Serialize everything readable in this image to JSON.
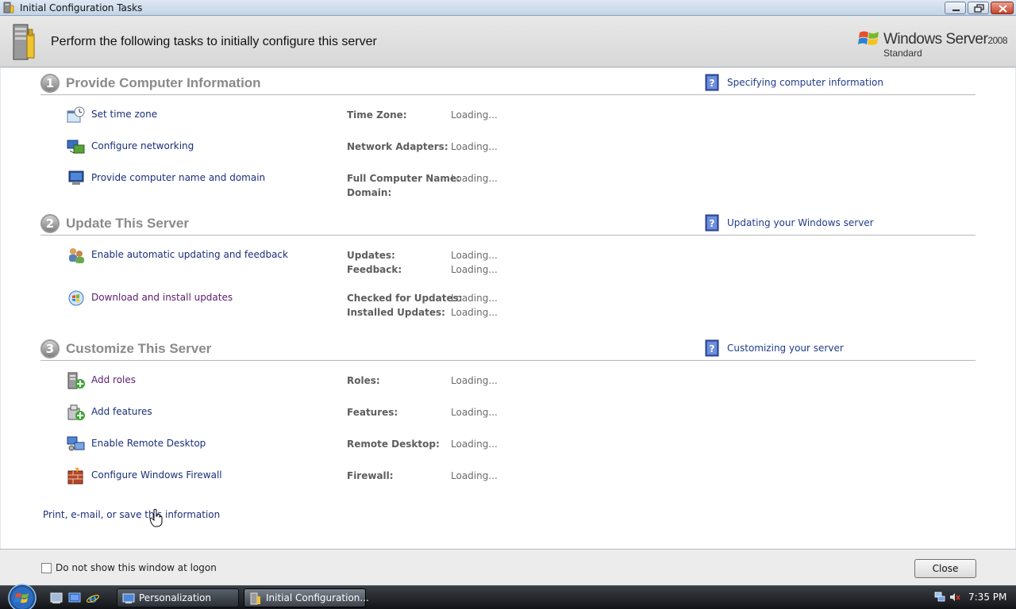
{
  "window": {
    "title": "Initial Configuration Tasks"
  },
  "header": {
    "title": "Perform the following tasks to initially configure this server",
    "brand_name": "Windows Server",
    "brand_version": "2008",
    "brand_edition": "Standard"
  },
  "sections": [
    {
      "number": "1",
      "title": "Provide Computer Information",
      "help_link": "Specifying computer information",
      "tasks": [
        {
          "label": "Set time zone",
          "icon": "clock-icon",
          "fields": [
            {
              "label": "Time Zone:",
              "value": "Loading..."
            }
          ]
        },
        {
          "label": "Configure networking",
          "icon": "network-icon",
          "fields": [
            {
              "label": "Network Adapters:",
              "value": "Loading..."
            }
          ]
        },
        {
          "label": "Provide computer name and domain",
          "icon": "computer-icon",
          "fields": [
            {
              "label": "Full Computer Name:",
              "value": "Loading..."
            },
            {
              "label": "Domain:",
              "value": ""
            }
          ]
        }
      ]
    },
    {
      "number": "2",
      "title": "Update This Server",
      "help_link": "Updating your Windows server",
      "tasks": [
        {
          "label": "Enable automatic updating and feedback",
          "icon": "users-icon",
          "fields": [
            {
              "label": "Updates:",
              "value": "Loading..."
            },
            {
              "label": "Feedback:",
              "value": "Loading..."
            }
          ]
        },
        {
          "label": "Download and install updates",
          "icon": "windows-update-icon",
          "fields": [
            {
              "label": "Checked for Updates:",
              "value": "Loading..."
            },
            {
              "label": "Installed Updates:",
              "value": "Loading..."
            }
          ]
        }
      ]
    },
    {
      "number": "3",
      "title": "Customize This Server",
      "help_link": "Customizing your server",
      "tasks": [
        {
          "label": "Add roles",
          "icon": "add-roles-icon",
          "fields": [
            {
              "label": "Roles:",
              "value": "Loading..."
            }
          ]
        },
        {
          "label": "Add features",
          "icon": "add-features-icon",
          "fields": [
            {
              "label": "Features:",
              "value": "Loading..."
            }
          ]
        },
        {
          "label": "Enable Remote Desktop",
          "icon": "remote-desktop-icon",
          "fields": [
            {
              "label": "Remote Desktop:",
              "value": "Loading..."
            }
          ]
        },
        {
          "label": "Configure Windows Firewall",
          "icon": "firewall-icon",
          "fields": [
            {
              "label": "Firewall:",
              "value": "Loading..."
            }
          ]
        }
      ]
    }
  ],
  "print_link": "Print, e-mail, or save this information",
  "footer": {
    "checkbox_label": "Do not show this window at logon",
    "checkbox_checked": false,
    "close_label": "Close"
  },
  "taskbar": {
    "buttons": [
      {
        "label": "Personalization",
        "icon": "personalization-icon"
      },
      {
        "label": "Initial Configuration...",
        "icon": "config-tasks-icon"
      }
    ],
    "quick_launch": [
      "show-desktop-icon",
      "server-manager-icon",
      "internet-explorer-icon"
    ],
    "clock": "7:35 PM"
  },
  "colors": {
    "link": "#1a2f7a",
    "visited_link": "#5b1d6e",
    "section_title": "#8a8a8a"
  }
}
